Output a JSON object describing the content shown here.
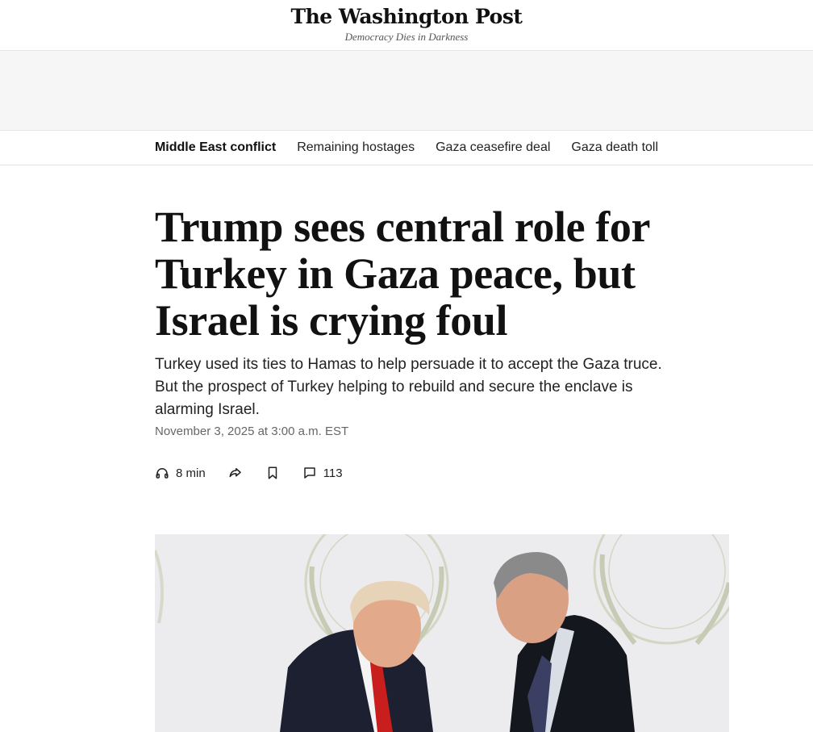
{
  "masthead": {
    "logo": "The Washington Post",
    "tagline": "Democracy Dies in Darkness"
  },
  "topic_nav": {
    "items": [
      {
        "label": "Middle East conflict",
        "active": true
      },
      {
        "label": "Remaining hostages",
        "active": false
      },
      {
        "label": "Gaza ceasefire deal",
        "active": false
      },
      {
        "label": "Gaza death toll",
        "active": false
      }
    ]
  },
  "article": {
    "headline_lines": [
      "Trump sees central role for",
      "Turkey in Gaza peace, but",
      "Israel is crying foul"
    ],
    "dek_lines": [
      "Turkey used its ties to Hamas to help persuade it to accept the Gaza truce.",
      "But the prospect of Turkey helping to rebuild and secure the enclave is",
      "alarming Israel."
    ],
    "dateline": "November 3, 2025 at 3:00 a.m. EST",
    "actions": {
      "listen_icon": "headphones-icon",
      "listen_label": "8 min",
      "share_icon": "share-arrow-icon",
      "save_icon": "bookmark-icon",
      "comments_icon": "comment-icon",
      "comments_count": "113"
    }
  },
  "hero_image": {
    "description_icon": "photo",
    "colors": {
      "background": "#ECEAED",
      "emblem": "#CDD2B8",
      "suit_dark": "#1A1E2C",
      "tie_red": "#C81E1E",
      "skin": "#E2A98A"
    }
  }
}
